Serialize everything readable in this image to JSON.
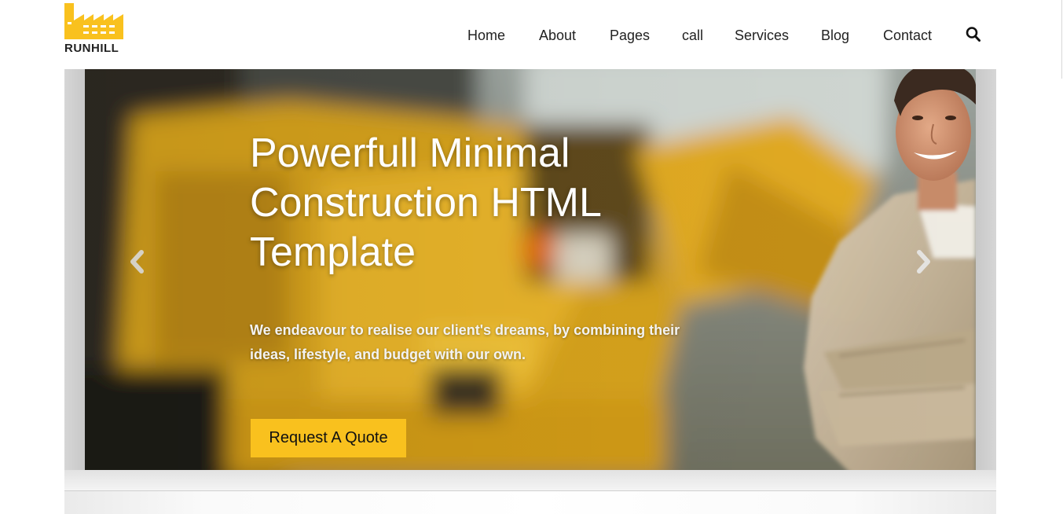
{
  "brand": {
    "name": "RUNHILL",
    "accent_color": "#f9c11e",
    "logo_icon": "factory-icon"
  },
  "nav": {
    "items": [
      {
        "label": "Home"
      },
      {
        "label": "About"
      },
      {
        "label": "Pages"
      },
      {
        "label": "call"
      },
      {
        "label": "Services"
      },
      {
        "label": "Blog"
      },
      {
        "label": "Contact"
      }
    ],
    "search_icon": "search-icon"
  },
  "hero": {
    "title": "Powerfull Minimal\nConstruction HTML\nTemplate",
    "subtitle": "We endeavour to realise our client's dreams, by combining their ideas, lifestyle, and budget with our own.",
    "cta_label": "Request A Quote",
    "prev_icon": "chevron-left-icon",
    "next_icon": "chevron-right-icon",
    "background_image": "construction-worker-with-yellow-excavator"
  }
}
